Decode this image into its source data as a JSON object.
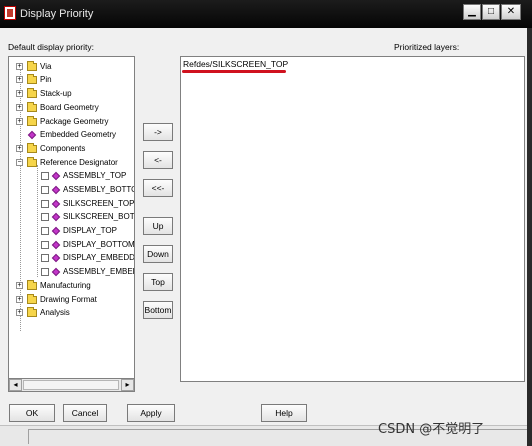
{
  "window": {
    "title": "Display Priority",
    "controls": {
      "minimize": "▁",
      "maximize": "□",
      "close": "✕"
    }
  },
  "labels": {
    "default": "Default display priority:",
    "prioritized": "Prioritized layers:"
  },
  "tree": {
    "top_items": [
      {
        "label": "Via",
        "expander": "+"
      },
      {
        "label": "Pin",
        "expander": "+"
      },
      {
        "label": "Stack-up",
        "expander": "+"
      },
      {
        "label": "Board Geometry",
        "expander": "+"
      },
      {
        "label": "Package Geometry",
        "expander": "+"
      },
      {
        "label": "Embedded Geometry",
        "expander": ""
      },
      {
        "label": "Components",
        "expander": "+"
      },
      {
        "label": "Reference Designator",
        "expander": "−"
      }
    ],
    "children": [
      {
        "label": "ASSEMBLY_TOP"
      },
      {
        "label": "ASSEMBLY_BOTTOM"
      },
      {
        "label": "SILKSCREEN_TOP"
      },
      {
        "label": "SILKSCREEN_BOTTOM"
      },
      {
        "label": "DISPLAY_TOP"
      },
      {
        "label": "DISPLAY_BOTTOM"
      },
      {
        "label": "DISPLAY_EMBEDDED"
      },
      {
        "label": "ASSEMBLY_EMBEDDED"
      }
    ],
    "bottom_items": [
      {
        "label": "Manufacturing",
        "expander": "+"
      },
      {
        "label": "Drawing Format",
        "expander": "+"
      },
      {
        "label": "Analysis",
        "expander": "+"
      }
    ]
  },
  "scroll": {
    "left": "◂",
    "right": "▸"
  },
  "transfer_buttons": {
    "add": "->",
    "remove": "<-",
    "remove_all": "<<-",
    "up": "Up",
    "down": "Down",
    "top": "Top",
    "bottom": "Bottom"
  },
  "prioritized": {
    "items": [
      "Refdes/SILKSCREEN_TOP"
    ]
  },
  "footer": {
    "ok": "OK",
    "cancel": "Cancel",
    "apply": "Apply",
    "help": "Help"
  },
  "watermark": "CSDN @不觉明了",
  "colors": {
    "title_bar": "#0b0b0b",
    "annotation_red": "#d0121f",
    "diamond": "#c235c8",
    "folder": "#f6d54a"
  }
}
